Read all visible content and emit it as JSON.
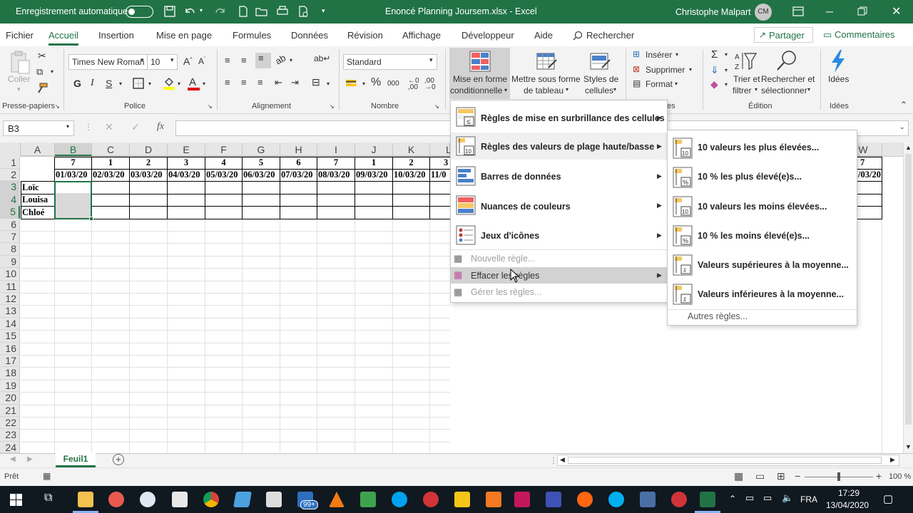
{
  "titlebar": {
    "autosave": "Enregistrement automatique",
    "title": "Enoncé Planning Joursem.xlsx  -  Excel",
    "user": "Christophe Malpart",
    "initials": "CM"
  },
  "tabs": [
    "Fichier",
    "Accueil",
    "Insertion",
    "Mise en page",
    "Formules",
    "Données",
    "Révision",
    "Affichage",
    "Développeur",
    "Aide"
  ],
  "search": "Rechercher",
  "share": "Partager",
  "comments": "Commentaires",
  "ribbon": {
    "paste": "Coller",
    "font_name": "Times New Roman",
    "font_size": "10",
    "number_format": "Standard",
    "mfc_label_1": "Mise en forme",
    "mfc_label_2": "conditionnelle",
    "table_label_1": "Mettre sous forme",
    "table_label_2": "de tableau",
    "styles_label_1": "Styles de",
    "styles_label_2": "cellules",
    "insert": "Insérer",
    "delete": "Supprimer",
    "format": "Format",
    "sort_1": "Trier et",
    "sort_2": "filtrer",
    "find_1": "Rechercher et",
    "find_2": "sélectionner",
    "ideas": "Idées",
    "groups": {
      "clipboard": "Presse-papiers",
      "font": "Police",
      "alignment": "Alignement",
      "number": "Nombre",
      "styles": "es",
      "editing": "Édition",
      "ideas": "Idées"
    }
  },
  "namebox": "B3",
  "columns": [
    "A",
    "B",
    "C",
    "D",
    "E",
    "F",
    "G",
    "H",
    "I",
    "J",
    "K",
    "L",
    "W"
  ],
  "rows": [
    "1",
    "2",
    "3",
    "4",
    "5",
    "6",
    "7",
    "8",
    "9",
    "10",
    "11",
    "12",
    "13",
    "14",
    "15",
    "16",
    "17",
    "18",
    "19",
    "20",
    "21",
    "22",
    "23",
    "24"
  ],
  "row1": [
    "7",
    "1",
    "2",
    "3",
    "4",
    "5",
    "6",
    "7",
    "1",
    "2",
    "3"
  ],
  "row2": [
    "01/03/20",
    "02/03/20",
    "03/03/20",
    "04/03/20",
    "05/03/20",
    "06/03/20",
    "07/03/20",
    "08/03/20",
    "09/03/20",
    "10/03/20",
    "11/0"
  ],
  "w_row1": "7",
  "w_row2": "/03/20",
  "names": [
    "Loïc",
    "Louisa",
    "Chloé"
  ],
  "mfc_menu": {
    "items": [
      "Règles de mise en surbrillance des cellules",
      "Règles des valeurs de plage haute/basse",
      "Barres de données",
      "Nuances de couleurs",
      "Jeux d'icônes"
    ],
    "new_rule": "Nouvelle règle...",
    "clear_rules": "Effacer les règles",
    "manage_rules": "Gérer les règles...",
    "icon_text": [
      "≤",
      "10"
    ]
  },
  "submenu": {
    "items": [
      "10 valeurs les plus élevées...",
      "10 % les plus élevé(e)s...",
      "10 valeurs les moins élevées...",
      "10 % les moins élevé(e)s...",
      "Valeurs supérieures à la moyenne...",
      "Valeurs inférieures à la moyenne..."
    ],
    "icon_text": [
      "10",
      "%",
      "10",
      "%",
      "x̄",
      "x̄"
    ],
    "more": "Autres règles..."
  },
  "sheet": "Feuil1",
  "status": "Prêt",
  "zoom": "100 %",
  "taskbar": {
    "badge": "99+",
    "lang": "FRA",
    "time": "17:29",
    "date": "13/04/2020"
  },
  "colors": {
    "excel_green": "#217346",
    "ribbon_bg": "#f3f3f3",
    "selection_gray": "#d9d9d9",
    "taskbar": "#101820"
  }
}
